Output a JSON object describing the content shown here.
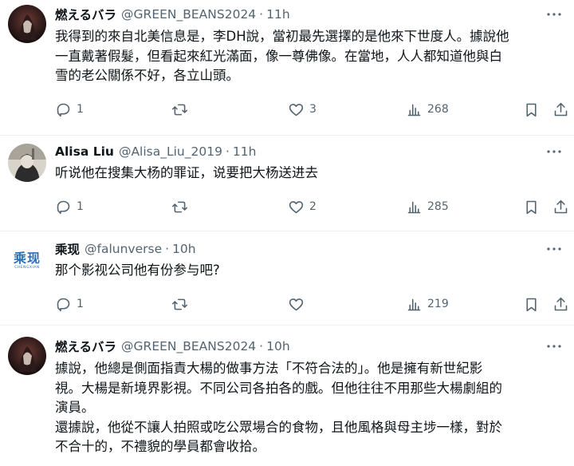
{
  "tweets": [
    {
      "name": "燃えるバラ",
      "handle": "@GREEN_BEANS2024",
      "dot": "·",
      "time": "11h",
      "lines": [
        "我得到的來自北美信息是，李DH說，當初最先選擇的是他來下世度人。據說他",
        "一直戴著假髮，但看起來紅光滿面，像一尊佛像。在當地，人人都知道他與白",
        "雪的老公關係不好，各立山頭。"
      ],
      "replies": "1",
      "retweets": "",
      "likes": "3",
      "views": "268"
    },
    {
      "name": "Alisa Liu",
      "handle": "@Alisa_Liu_2019",
      "dot": "·",
      "time": "11h",
      "lines": [
        "听说他在搜集大杨的罪证，说要把大杨送进去"
      ],
      "replies": "1",
      "retweets": "",
      "likes": "2",
      "views": "285"
    },
    {
      "name": "乘现",
      "handle": "@falunverse",
      "dot": "·",
      "time": "10h",
      "avatar_text": "乘现",
      "avatar_sub": "CHENGXIAN",
      "lines": [
        "那个影视公司他有份参与吧?"
      ],
      "replies": "1",
      "retweets": "",
      "likes": "",
      "views": "219"
    },
    {
      "name": "燃えるバラ",
      "handle": "@GREEN_BEANS2024",
      "dot": "·",
      "time": "10h",
      "lines": [
        "據說，他總是側面指責大楊的做事方法「不符合法的」。他是擁有新世紀影",
        "視。大楊是新境界影視。不同公司各拍各的戲。但他往往不用那些大楊劇組的",
        "演員。",
        "還據說，他從不讓人拍照或吃公眾場合的食物，且他風格與母主埗一樣，對於",
        "不合十的，不禮貌的學員都會收拾。"
      ]
    }
  ],
  "icons": {
    "reply": "reply-icon",
    "retweet": "retweet-icon",
    "like": "heart-icon",
    "views": "views-icon",
    "bookmark": "bookmark-icon",
    "share": "share-icon",
    "more": "more-icon"
  },
  "colors": {
    "text": "#0f1419",
    "muted": "#536471",
    "divider": "#eff3f4",
    "logo_blue": "#2b6fb6"
  }
}
